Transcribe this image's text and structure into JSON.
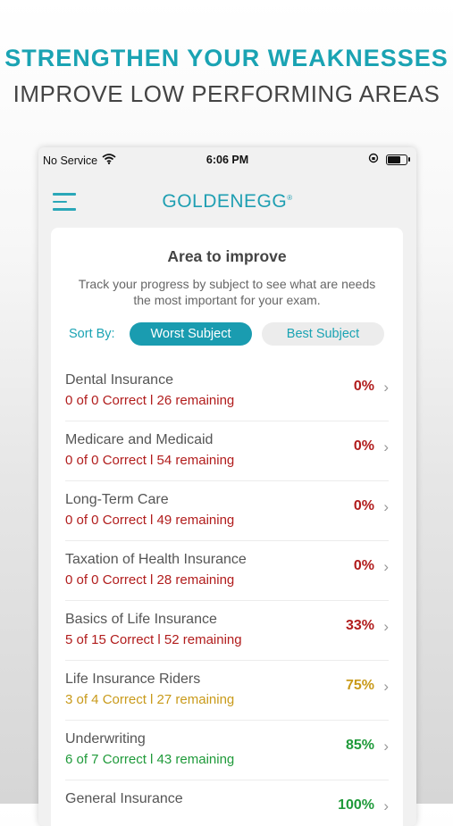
{
  "promo": {
    "headline": "STRENGTHEN YOUR WEAKNESSES",
    "subline": "IMPROVE LOW PERFORMING AREAS"
  },
  "status_bar": {
    "carrier": "No Service",
    "time": "6:06 PM",
    "battery_level": 0.7
  },
  "app": {
    "logo": "GOLDENEGG",
    "logo_mark": "®"
  },
  "card": {
    "title": "Area to improve",
    "description": "Track your progress by subject to see what are needs the most important for your exam.",
    "sort_label": "Sort By:",
    "sort_worst": "Worst Subject",
    "sort_best": "Best Subject"
  },
  "subjects": [
    {
      "name": "Dental Insurance",
      "stats": "0 of 0  Correct l 26 remaining",
      "pct": "0%",
      "color": "#b11c1c"
    },
    {
      "name": "Medicare and Medicaid",
      "stats": "0 of 0  Correct l 54 remaining",
      "pct": "0%",
      "color": "#b11c1c"
    },
    {
      "name": "Long-Term Care",
      "stats": "0 of 0  Correct l 49 remaining",
      "pct": "0%",
      "color": "#b11c1c"
    },
    {
      "name": "Taxation of Health Insurance",
      "stats": "0 of 0  Correct l 28 remaining",
      "pct": "0%",
      "color": "#b11c1c"
    },
    {
      "name": "Basics of Life Insurance",
      "stats": "5 of 15  Correct l 52 remaining",
      "pct": "33%",
      "color": "#b11c1c"
    },
    {
      "name": "Life Insurance Riders",
      "stats": "3 of 4  Correct l 27 remaining",
      "pct": "75%",
      "color": "#c99a1a"
    },
    {
      "name": "Underwriting",
      "stats": "6 of 7  Correct l 43 remaining",
      "pct": "85%",
      "color": "#1f9a3a"
    },
    {
      "name": "General Insurance",
      "stats": "",
      "pct": "100%",
      "color": "#1f9a3a"
    }
  ],
  "colors": {
    "accent": "#1aa3b3",
    "low": "#b11c1c",
    "mid": "#c99a1a",
    "high": "#1f9a3a"
  },
  "icons": [
    "wifi-icon",
    "orientation-lock-icon",
    "battery-icon",
    "menu-icon",
    "chevron-right-icon"
  ]
}
